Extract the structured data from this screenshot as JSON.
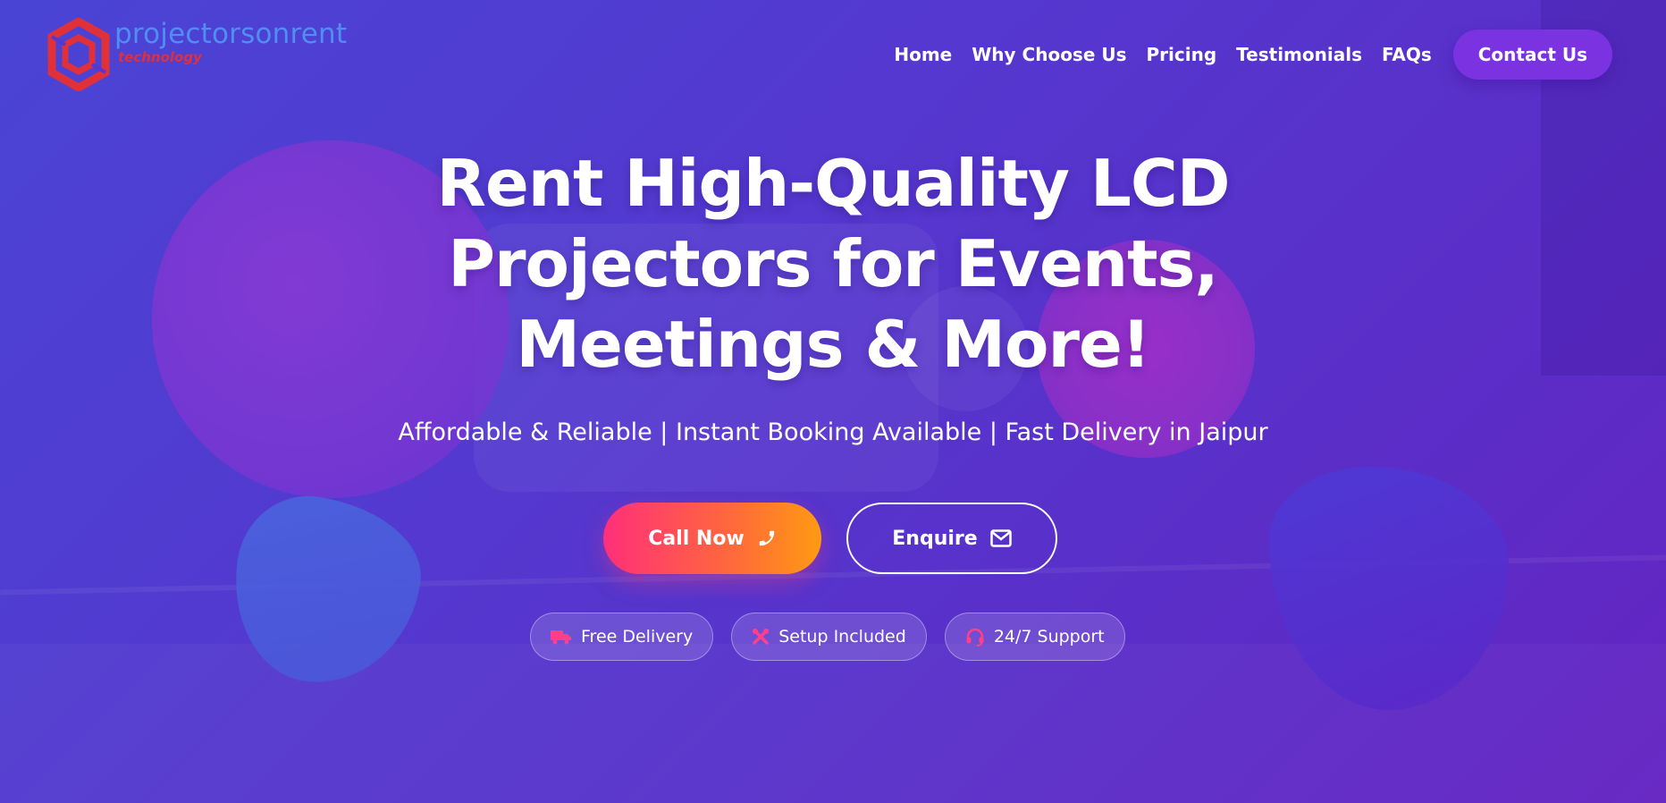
{
  "brand": {
    "name": "projectorsonrent",
    "tagline": "technology",
    "logo_icon": "hexagon-logo-icon",
    "name_color": "#4f8ef2",
    "tagline_color": "#e0303a"
  },
  "nav": {
    "items": [
      {
        "label": "Home"
      },
      {
        "label": "Why Choose Us"
      },
      {
        "label": "Pricing"
      },
      {
        "label": "Testimonials"
      },
      {
        "label": "FAQs"
      }
    ],
    "cta_label": "Contact Us",
    "cta_color": "#7b32e0"
  },
  "hero": {
    "headline_lines": [
      "Rent High-Quality LCD",
      "Projectors for Events,",
      "Meetings & More!"
    ],
    "subtitle": "Affordable & Reliable | Instant Booking Available | Fast Delivery in Jaipur",
    "call_button": {
      "label": "Call Now",
      "icon": "phone-icon"
    },
    "enquire_button": {
      "label": "Enquire",
      "icon": "envelope-icon"
    },
    "badges": [
      {
        "label": "Free Delivery",
        "icon": "truck-icon"
      },
      {
        "label": "Setup Included",
        "icon": "tools-icon"
      },
      {
        "label": "24/7 Support",
        "icon": "headset-icon"
      }
    ],
    "accent_color": "#ff2f7a",
    "background_color": "#5438cf"
  }
}
